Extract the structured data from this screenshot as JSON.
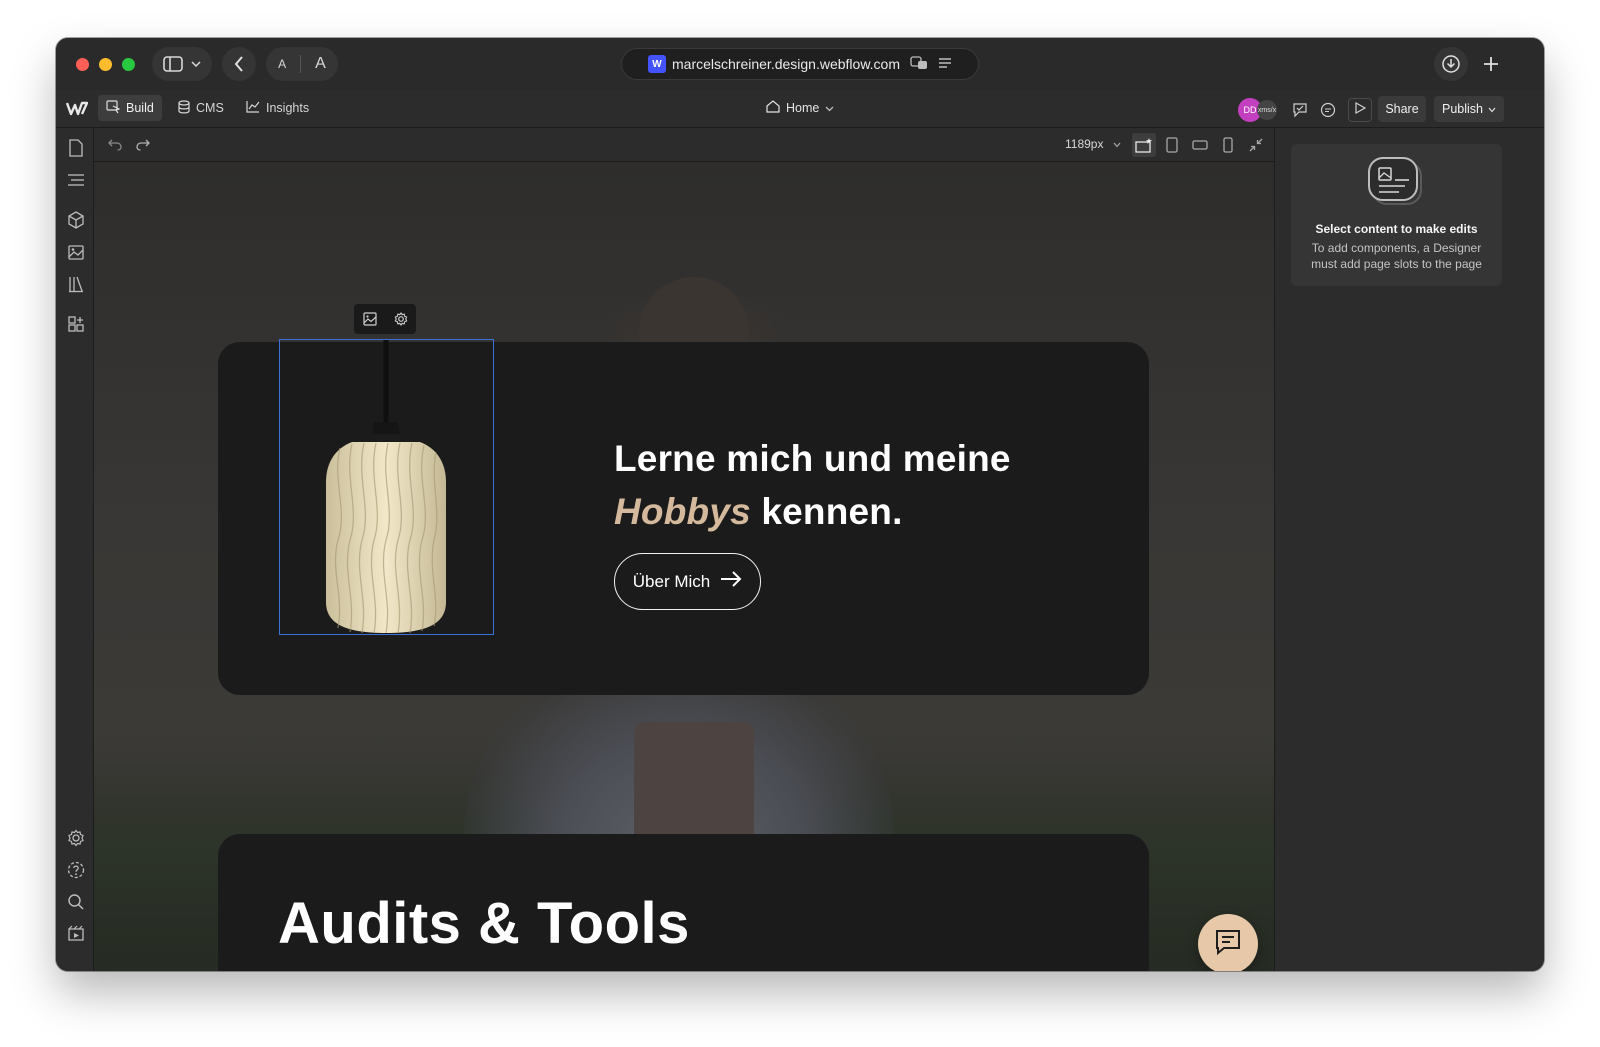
{
  "browser": {
    "url": "marcelschreiner.design.webflow.com",
    "reader_a_small": "A",
    "reader_a_large": "A",
    "favicon_text": "W"
  },
  "webflow": {
    "logo": "W",
    "tabs": [
      {
        "label": "Build",
        "icon": "cursor-icon"
      },
      {
        "label": "CMS",
        "icon": "database-icon"
      },
      {
        "label": "Insights",
        "icon": "chart-icon"
      }
    ],
    "page_selector": "Home",
    "avatar_initials": "DD",
    "avatar2_text": "xms/x",
    "share_label": "Share",
    "publish_label": "Publish"
  },
  "canvas_toolbar": {
    "width_value": "1189px"
  },
  "page": {
    "headline_line1": "Lerne mich und meine",
    "headline_accent": "Hobbys",
    "headline_rest": " kennen.",
    "cta_label": "Über Mich",
    "section_title": "Audits & Tools"
  },
  "right_panel": {
    "title": "Select content to make edits",
    "text": "To add components, a Designer must add page slots to the page"
  },
  "colors": {
    "accent_text": "#d4b99c",
    "selection": "#3a72d8",
    "chat_fab": "#e7c9aa",
    "avatar": "#c23fbf"
  }
}
